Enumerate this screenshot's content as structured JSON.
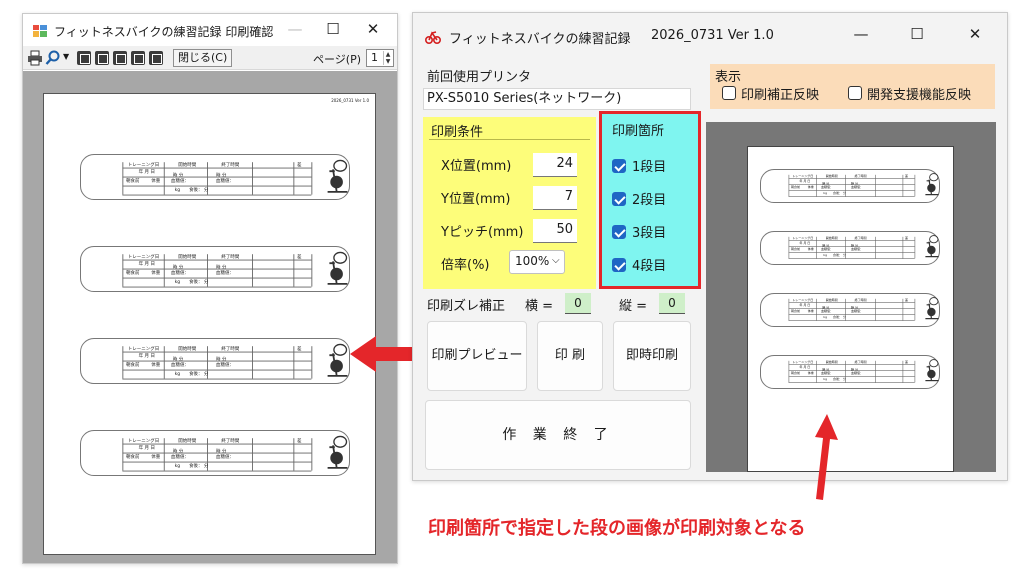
{
  "preview_window": {
    "title": "フィットネスバイクの練習記録 印刷確認",
    "toolbar": {
      "close_label": "閉じる(C)",
      "page_label": "ページ(P)",
      "page_value": "1"
    },
    "stamp": "2026_0731  Ver 1.0"
  },
  "card": {
    "training_day": "トレーニング日",
    "start_time": "開始時間",
    "end_time": "終了時間",
    "ban": "差",
    "date_line": "年  月  日",
    "hour_min": "時    分",
    "before_meal": "朝食前",
    "weight": "体重",
    "bp_high": "血糖値：",
    "bp_low": "血糖値：",
    "kg": "kg",
    "meal_after": "食後：  分"
  },
  "main_window": {
    "title": "フィットネスバイクの練習記録",
    "version": "2026_0731  Ver 1.0",
    "printer_label": "前回使用プリンタ",
    "printer_value": "PX-S5010 Series(ネットワーク)",
    "display": {
      "label": "表示",
      "opt1": "印刷補正反映",
      "opt2": "開発支援機能反映",
      "opt1_checked": false,
      "opt2_checked": false
    },
    "conditions": {
      "label": "印刷条件",
      "x_label": "X位置(mm)",
      "x_value": "24",
      "y_label": "Y位置(mm)",
      "y_value": "7",
      "pitch_label": "Yピッチ(mm)",
      "pitch_value": "50",
      "scale_label": "倍率(%)",
      "scale_value": "100%"
    },
    "positions": {
      "label": "印刷箇所",
      "items": [
        {
          "label": "1段目",
          "checked": true
        },
        {
          "label": "2段目",
          "checked": true
        },
        {
          "label": "3段目",
          "checked": true
        },
        {
          "label": "4段目",
          "checked": true
        }
      ]
    },
    "offset": {
      "label": "印刷ズレ補正",
      "h_label": "横 =",
      "h_value": "0",
      "v_label": "縦 =",
      "v_value": "0"
    },
    "buttons": {
      "preview": "印刷プレビュー",
      "print": "印 刷",
      "instant": "即時印刷",
      "finish": "作 業 終 了"
    }
  },
  "annotation": "印刷箇所で指定した段の画像が印刷対象となる",
  "colors": {
    "accent_red": "#e4262a",
    "conditions_bg": "#fdfd7a",
    "positions_bg": "#7ff5f0",
    "display_bg": "#fbdcb9",
    "checkbox_blue": "#1f66c4"
  }
}
